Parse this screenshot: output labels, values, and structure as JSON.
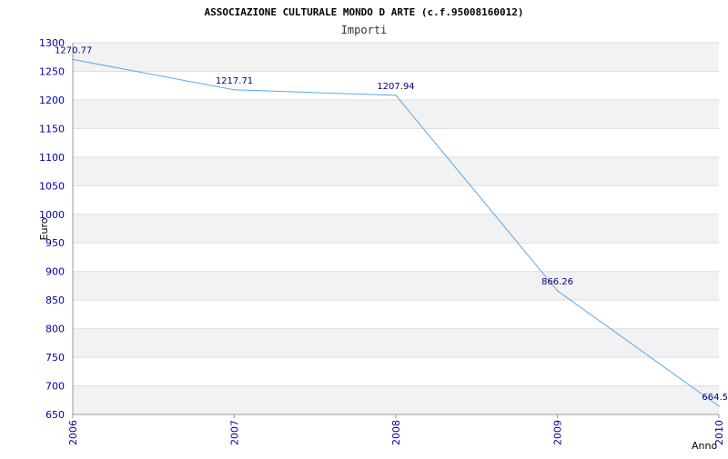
{
  "chart_data": {
    "type": "line",
    "title": "ASSOCIAZIONE CULTURALE MONDO D ARTE (c.f.95008160012)",
    "subtitle": "Importi",
    "xlabel": "Anno",
    "ylabel": "Euro",
    "categories": [
      "2006",
      "2007",
      "2008",
      "2009",
      "2010"
    ],
    "series": [
      {
        "values": [
          1270.77,
          1217.71,
          1207.94,
          866.26,
          664.5
        ]
      }
    ],
    "data_labels": [
      "1270.77",
      "1217.71",
      "1207.94",
      "866.26",
      "664.5"
    ],
    "ylim": [
      650,
      1300
    ],
    "yticks": [
      650,
      700,
      750,
      800,
      850,
      900,
      950,
      1000,
      1050,
      1100,
      1150,
      1200,
      1250,
      1300
    ],
    "grid": true,
    "line_color": "#5aa9e6",
    "band_color": "#f2f2f2",
    "tick_color": "#0000aa"
  }
}
